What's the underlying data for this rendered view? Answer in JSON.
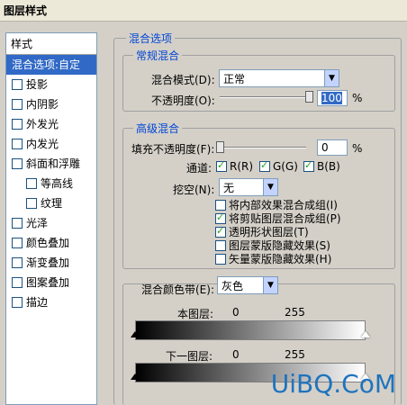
{
  "window": {
    "title": "图层样式"
  },
  "style_list": {
    "header": "样式",
    "items": [
      {
        "label": "混合选项:自定",
        "checkbox": false,
        "selected": true,
        "indent": false
      },
      {
        "label": "投影",
        "checkbox": true,
        "checked": false,
        "indent": false
      },
      {
        "label": "内阴影",
        "checkbox": true,
        "checked": false,
        "indent": false
      },
      {
        "label": "外发光",
        "checkbox": true,
        "checked": false,
        "indent": false
      },
      {
        "label": "内发光",
        "checkbox": true,
        "checked": false,
        "indent": false
      },
      {
        "label": "斜面和浮雕",
        "checkbox": true,
        "checked": false,
        "indent": false
      },
      {
        "label": "等高线",
        "checkbox": true,
        "checked": false,
        "indent": true
      },
      {
        "label": "纹理",
        "checkbox": true,
        "checked": false,
        "indent": true
      },
      {
        "label": "光泽",
        "checkbox": true,
        "checked": false,
        "indent": false
      },
      {
        "label": "颜色叠加",
        "checkbox": true,
        "checked": false,
        "indent": false
      },
      {
        "label": "渐变叠加",
        "checkbox": true,
        "checked": false,
        "indent": false
      },
      {
        "label": "图案叠加",
        "checkbox": true,
        "checked": false,
        "indent": false
      },
      {
        "label": "描边",
        "checkbox": true,
        "checked": false,
        "indent": false
      }
    ]
  },
  "blending_options": {
    "title": "混合选项",
    "general": {
      "title": "常规混合",
      "mode_label": "混合模式(D):",
      "mode_value": "正常",
      "opacity_label": "不透明度(O):",
      "opacity_value": "100",
      "opacity_unit": "%",
      "opacity_fraction": 1.0
    },
    "advanced": {
      "title": "高级混合",
      "fill_label": "填充不透明度(F):",
      "fill_value": "0",
      "fill_unit": "%",
      "fill_fraction": 0.0,
      "channels_label": "通道:",
      "channels": [
        {
          "label": "R(R)",
          "checked": true
        },
        {
          "label": "G(G)",
          "checked": true
        },
        {
          "label": "B(B)",
          "checked": true
        }
      ],
      "knockout_label": "挖空(N):",
      "knockout_value": "无",
      "options": [
        {
          "label": "将内部效果混合成组(I)",
          "checked": false
        },
        {
          "label": "将剪贴图层混合成组(P)",
          "checked": true
        },
        {
          "label": "透明形状图层(T)",
          "checked": true
        },
        {
          "label": "图层蒙版隐藏效果(S)",
          "checked": false
        },
        {
          "label": "矢量蒙版隐藏效果(H)",
          "checked": false
        }
      ]
    },
    "blend_if": {
      "label": "混合颜色带(E):",
      "value": "灰色",
      "this_layer_label": "本图层:",
      "this_layer_min": "0",
      "this_layer_max": "255",
      "underlying_label": "下一图层:",
      "underlying_min": "0",
      "underlying_max": "255"
    }
  },
  "watermark": "UiBQ.CoM"
}
